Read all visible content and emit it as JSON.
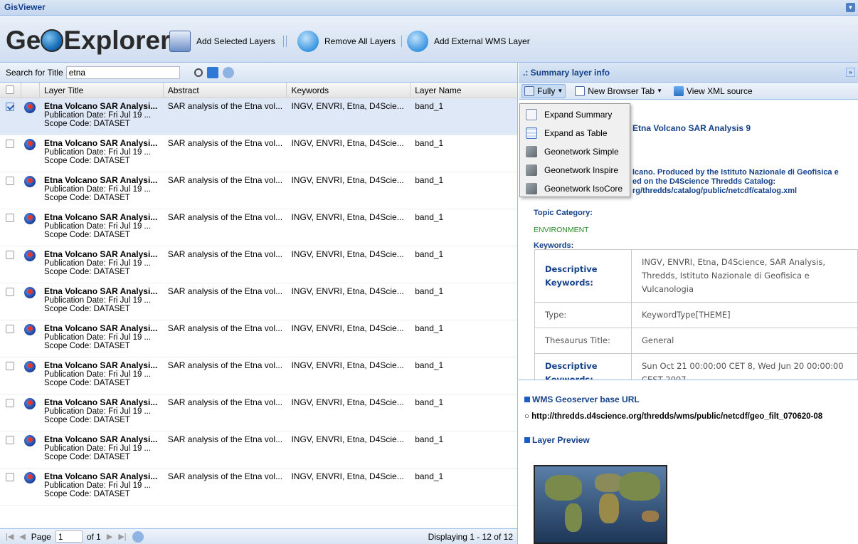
{
  "window": {
    "title": "GisViewer"
  },
  "toolbar": {
    "logo": "GeOExplorer",
    "add_selected": "Add Selected Layers",
    "remove_all": "Remove All Layers",
    "add_external": "Add External WMS Layer"
  },
  "search": {
    "label": "Search for Title",
    "value": "etna"
  },
  "grid": {
    "columns": [
      "Layer Title",
      "Abstract",
      "Keywords",
      "Layer Name"
    ],
    "rows": [
      {
        "title": "Etna Volcano SAR Analysi...",
        "pub": "Publication Date: Fri Jul 19 ...",
        "scope": "Scope Code: DATASET",
        "abstract": "SAR analysis of the Etna vol...",
        "keywords": "INGV, ENVRI, Etna, D4Scie...",
        "name": "band_1",
        "selected": true
      },
      {
        "title": "Etna Volcano SAR Analysi...",
        "pub": "Publication Date: Fri Jul 19 ...",
        "scope": "Scope Code: DATASET",
        "abstract": "SAR analysis of the Etna vol...",
        "keywords": "INGV, ENVRI, Etna, D4Scie...",
        "name": "band_1",
        "selected": false
      },
      {
        "title": "Etna Volcano SAR Analysi...",
        "pub": "Publication Date: Fri Jul 19 ...",
        "scope": "Scope Code: DATASET",
        "abstract": "SAR analysis of the Etna vol...",
        "keywords": "INGV, ENVRI, Etna, D4Scie...",
        "name": "band_1",
        "selected": false
      },
      {
        "title": "Etna Volcano SAR Analysi...",
        "pub": "Publication Date: Fri Jul 19 ...",
        "scope": "Scope Code: DATASET",
        "abstract": "SAR analysis of the Etna vol...",
        "keywords": "INGV, ENVRI, Etna, D4Scie...",
        "name": "band_1",
        "selected": false
      },
      {
        "title": "Etna Volcano SAR Analysi...",
        "pub": "Publication Date: Fri Jul 19 ...",
        "scope": "Scope Code: DATASET",
        "abstract": "SAR analysis of the Etna vol...",
        "keywords": "INGV, ENVRI, Etna, D4Scie...",
        "name": "band_1",
        "selected": false
      },
      {
        "title": "Etna Volcano SAR Analysi...",
        "pub": "Publication Date: Fri Jul 19 ...",
        "scope": "Scope Code: DATASET",
        "abstract": "SAR analysis of the Etna vol...",
        "keywords": "INGV, ENVRI, Etna, D4Scie...",
        "name": "band_1",
        "selected": false
      },
      {
        "title": "Etna Volcano SAR Analysi...",
        "pub": "Publication Date: Fri Jul 19 ...",
        "scope": "Scope Code: DATASET",
        "abstract": "SAR analysis of the Etna vol...",
        "keywords": "INGV, ENVRI, Etna, D4Scie...",
        "name": "band_1",
        "selected": false
      },
      {
        "title": "Etna Volcano SAR Analysi...",
        "pub": "Publication Date: Fri Jul 19 ...",
        "scope": "Scope Code: DATASET",
        "abstract": "SAR analysis of the Etna vol...",
        "keywords": "INGV, ENVRI, Etna, D4Scie...",
        "name": "band_1",
        "selected": false
      },
      {
        "title": "Etna Volcano SAR Analysi...",
        "pub": "Publication Date: Fri Jul 19 ...",
        "scope": "Scope Code: DATASET",
        "abstract": "SAR analysis of the Etna vol...",
        "keywords": "INGV, ENVRI, Etna, D4Scie...",
        "name": "band_1",
        "selected": false
      },
      {
        "title": "Etna Volcano SAR Analysi...",
        "pub": "Publication Date: Fri Jul 19 ...",
        "scope": "Scope Code: DATASET",
        "abstract": "SAR analysis of the Etna vol...",
        "keywords": "INGV, ENVRI, Etna, D4Scie...",
        "name": "band_1",
        "selected": false
      },
      {
        "title": "Etna Volcano SAR Analysi...",
        "pub": "Publication Date: Fri Jul 19 ...",
        "scope": "Scope Code: DATASET",
        "abstract": "SAR analysis of the Etna vol...",
        "keywords": "INGV, ENVRI, Etna, D4Scie...",
        "name": "band_1",
        "selected": false
      }
    ]
  },
  "pager": {
    "page_label": "Page",
    "page_value": "1",
    "of": "of 1",
    "displaying": "Displaying 1 - 12 of 12"
  },
  "summary": {
    "header": ".: Summary layer info",
    "btn_fully": "Fully",
    "btn_newtab": "New Browser Tab",
    "btn_xml": "View XML source",
    "menu": [
      "Expand Summary",
      "Expand as Table",
      "Geonetwork Simple",
      "Geonetwork Inspire",
      "Geonetwork IsoCore"
    ],
    "title": "Etna Volcano SAR Analysis 9",
    "abstract_l1": "lcano. Produced by the Istituto Nazionale di Geofisica e",
    "abstract_l2": "ed on the D4Science Thredds Catalog:",
    "abstract_l3": "rg/thredds/catalog/public/netcdf/catalog.xml",
    "topic_label": "Topic Category:",
    "topic_value": "ENVIRONMENT",
    "keywords_label": "Keywords:",
    "kw_rows": [
      {
        "k": "Descriptive Keywords:",
        "v": "INGV, ENVRI, Etna, D4Science, SAR Analysis, Thredds, Istituto Nazionale di Geofisica e Vulcanologia"
      },
      {
        "k": "Type:",
        "v": "KeywordType[THEME]"
      },
      {
        "k": "Thesaurus Title:",
        "v": "General"
      },
      {
        "k": "Descriptive Keywords:",
        "v": "Sun Oct 21 00:00:00 CET 8, Wed Jun 20 00:00:00 CEST 2007"
      }
    ]
  },
  "wms": {
    "title": "WMS Geoserver base URL",
    "url": "○ http://thredds.d4science.org/thredds/wms/public/netcdf/geo_filt_070620-08",
    "preview_title": "Layer Preview"
  }
}
